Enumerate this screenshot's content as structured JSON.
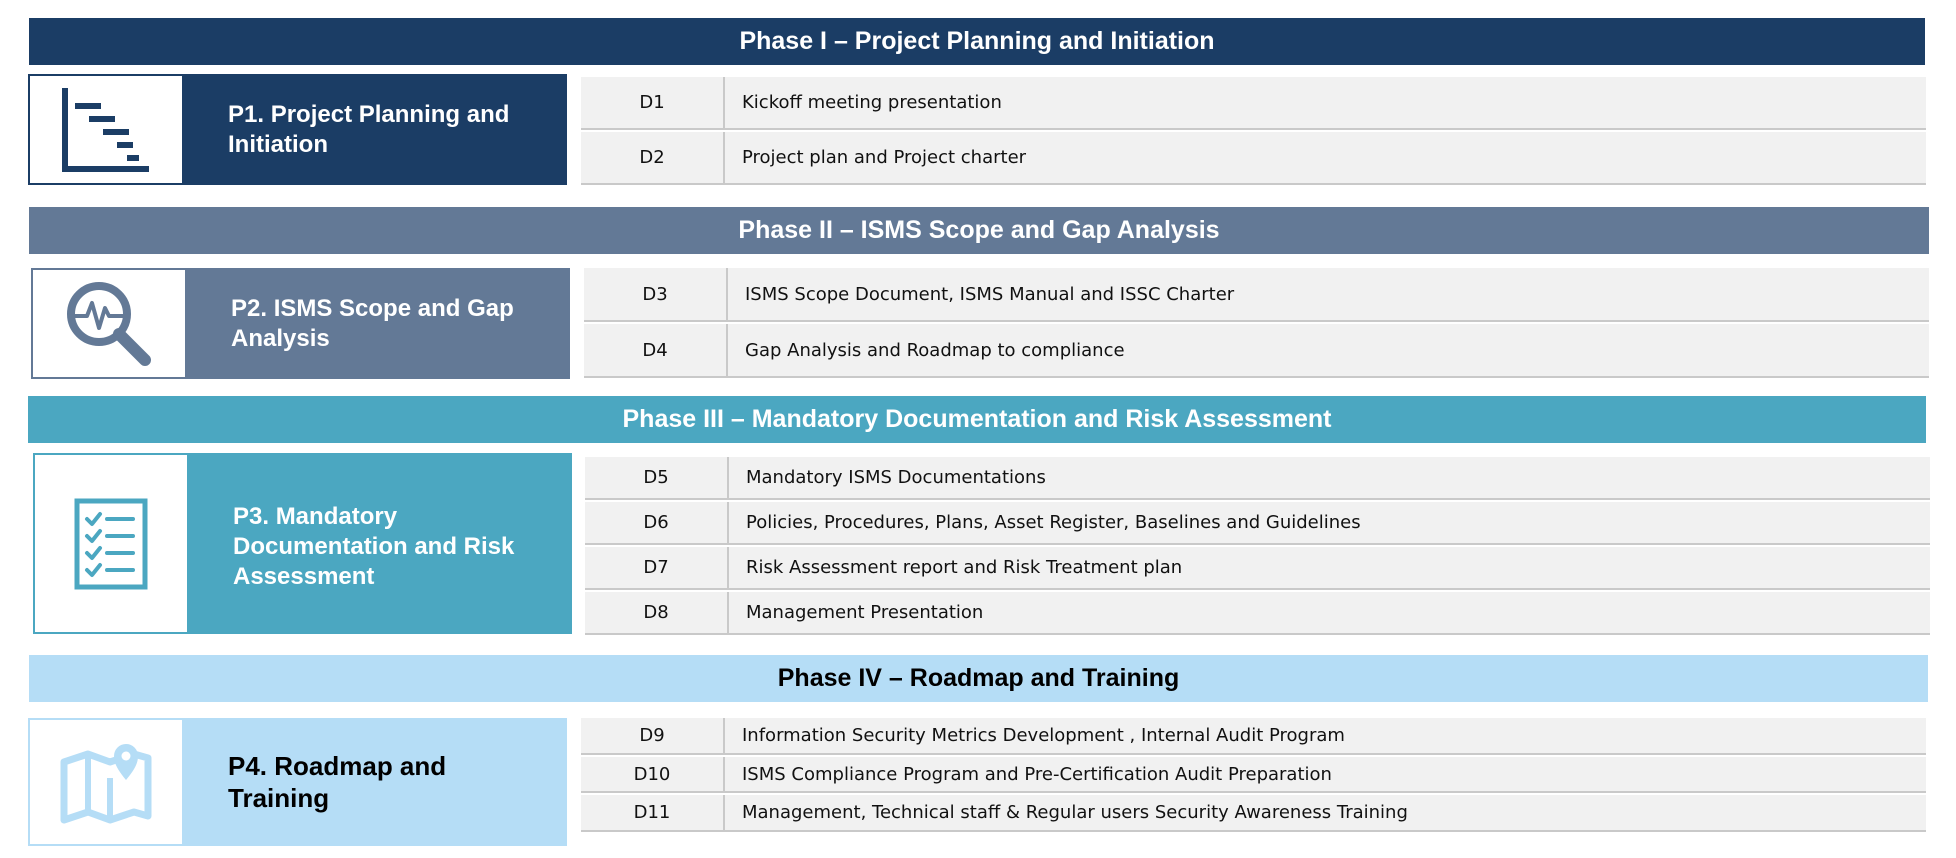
{
  "colors": {
    "phase1": "#1b3d65",
    "phase2": "#637996",
    "phase3": "#4ba7c1",
    "phase4": "#b5ddf6",
    "row_bg": "#f1f1f1",
    "row_line": "#c9c9c9"
  },
  "phases": [
    {
      "title": "Phase I – Project Planning and Initiation",
      "card_title": "P1. Project Planning and Initiation",
      "icon": "gantt-chart-icon",
      "deliverables": [
        {
          "code": "D1",
          "text": "Kickoff meeting presentation"
        },
        {
          "code": "D2",
          "text": "Project plan and Project charter"
        }
      ]
    },
    {
      "title": "Phase II – ISMS Scope and Gap Analysis",
      "card_title": "P2. ISMS Scope and Gap Analysis",
      "icon": "magnifier-pulse-icon",
      "deliverables": [
        {
          "code": "D3",
          "text": "ISMS Scope Document, ISMS Manual and ISSC Charter"
        },
        {
          "code": "D4",
          "text": "Gap Analysis and Roadmap to compliance"
        }
      ]
    },
    {
      "title": "Phase III – Mandatory Documentation and Risk Assessment",
      "card_title": "P3. Mandatory Documentation and Risk Assessment",
      "icon": "checklist-icon",
      "deliverables": [
        {
          "code": "D5",
          "text": "Mandatory ISMS Documentations"
        },
        {
          "code": "D6",
          "text": "Policies, Procedures, Plans, Asset Register, Baselines and Guidelines"
        },
        {
          "code": "D7",
          "text": "Risk Assessment report and Risk Treatment plan"
        },
        {
          "code": "D8",
          "text": "Management Presentation"
        }
      ]
    },
    {
      "title": "Phase IV – Roadmap and Training",
      "card_title": "P4. Roadmap and Training",
      "icon": "map-pin-icon",
      "deliverables": [
        {
          "code": "D9",
          "text": "Information Security Metrics Development , Internal Audit Program"
        },
        {
          "code": "D10",
          "text": "ISMS Compliance Program and Pre-Certification Audit Preparation"
        },
        {
          "code": "D11",
          "text": "Management, Technical staff & Regular users Security Awareness Training"
        }
      ]
    }
  ]
}
